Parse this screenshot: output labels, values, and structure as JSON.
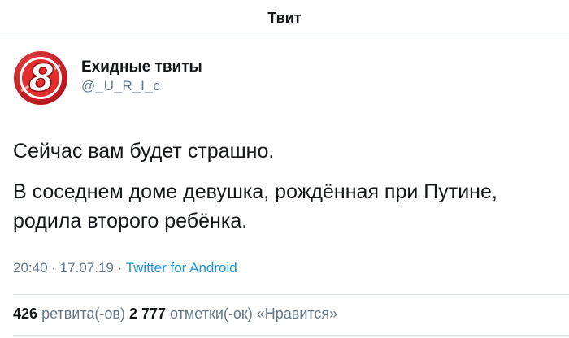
{
  "header": {
    "title": "Твит"
  },
  "author": {
    "display_name": "Ехидные твиты",
    "handle": "@_U_R_I_c",
    "avatar_icon": "number-8-logo-icon",
    "avatar_colors": {
      "ring": "#b3111a",
      "fill": "#e32b2b",
      "digit": "#ffffff"
    }
  },
  "tweet": {
    "lines": [
      "Сейчас вам будет страшно.",
      "В соседнем доме девушка, рождённая при Путине, родила второго ребёнка."
    ]
  },
  "meta": {
    "time": "20:40",
    "separator": "·",
    "date": "17.07.19",
    "source": "Twitter for Android"
  },
  "stats": {
    "retweets_count": "426",
    "retweets_label": "ретвита(-ов)",
    "likes_count": "2 777",
    "likes_label": "отметки(-ок) «Нравится»"
  },
  "colors": {
    "link": "#1b95e0",
    "secondary": "#657786",
    "divider": "#e1e8ed"
  }
}
